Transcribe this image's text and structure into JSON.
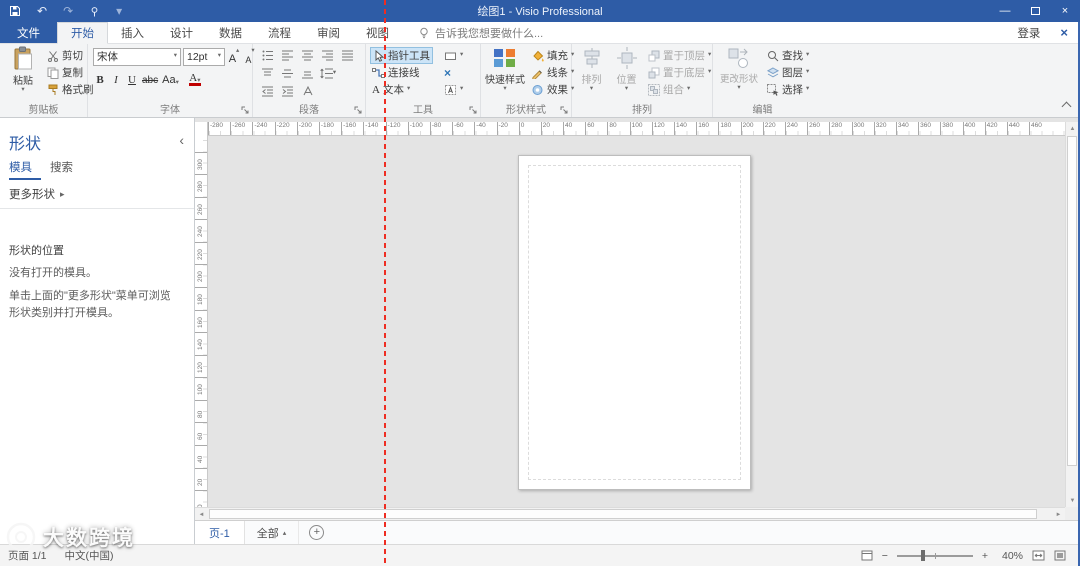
{
  "brand_color": "#2e5ca6",
  "glyphs": {
    "dropdown": "▾",
    "up_small": "▴",
    "collapse_left": "‹",
    "more_arrow": "▸",
    "scroll_left": "◄",
    "scroll_right": "►",
    "scroll_up": "▲",
    "scroll_down": "▼",
    "close": "×",
    "minimize": "—",
    "undo": "↶",
    "redo": "↷",
    "plus": "+"
  },
  "titlebar": {
    "title": "绘图1 - Visio Professional"
  },
  "tabs": {
    "file": "文件",
    "items": [
      "开始",
      "插入",
      "设计",
      "数据",
      "流程",
      "审阅",
      "视图"
    ],
    "active": "开始",
    "tell_me": "告诉我您想要做什么...",
    "sign_in": "登录"
  },
  "ribbon": {
    "clipboard": {
      "label": "剪贴板",
      "paste": "粘贴",
      "cut": "剪切",
      "copy": "复制",
      "format_painter": "格式刷"
    },
    "font": {
      "label": "字体",
      "family": "宋体",
      "size": "12pt",
      "grow": "A",
      "shrink": "A",
      "bold": "B",
      "italic": "I",
      "underline": "U",
      "strikethrough": "abc",
      "case_toggle": "Aa",
      "color": "A"
    },
    "paragraph": {
      "label": "段落"
    },
    "tools": {
      "label": "工具",
      "pointer": "指针工具",
      "connector": "连接线",
      "text": "文本",
      "text_icon": "A"
    },
    "shape_styles": {
      "label": "形状样式",
      "quick_styles": "快速样式",
      "fill": "填充",
      "line": "线条",
      "effects": "效果"
    },
    "arrange": {
      "label": "排列",
      "align": "排列",
      "position": "位置",
      "bring_to_front": "置于顶层",
      "send_to_back": "置于底层",
      "group": "组合"
    },
    "editing": {
      "label": "编辑",
      "change_shape": "更改形状",
      "find": "查找",
      "layers": "图层",
      "select": "选择"
    }
  },
  "shapes_panel": {
    "title": "形状",
    "stencils_tab": "模具",
    "search_tab": "搜索",
    "more_shapes": "更多形状",
    "location_heading": "形状的位置",
    "no_stencils": "没有打开的模具。",
    "hint": "单击上面的\"更多形状\"菜单可浏览形状类别并打开模具。"
  },
  "rulers": {
    "horizontal": {
      "from": -280,
      "to": 460,
      "step": 20
    },
    "vertical": {
      "from": 300,
      "to": 0,
      "step": 20
    }
  },
  "pagebar": {
    "page_tab": "页-1",
    "all_pages": "全部",
    "add_page": "+"
  },
  "statusbar": {
    "page_info": "页面 1/1",
    "language": "中文(中国)",
    "zoom_out": "−",
    "zoom_in": "+",
    "zoom_level": "40%"
  },
  "watermark": {
    "text": "大数跨境"
  }
}
